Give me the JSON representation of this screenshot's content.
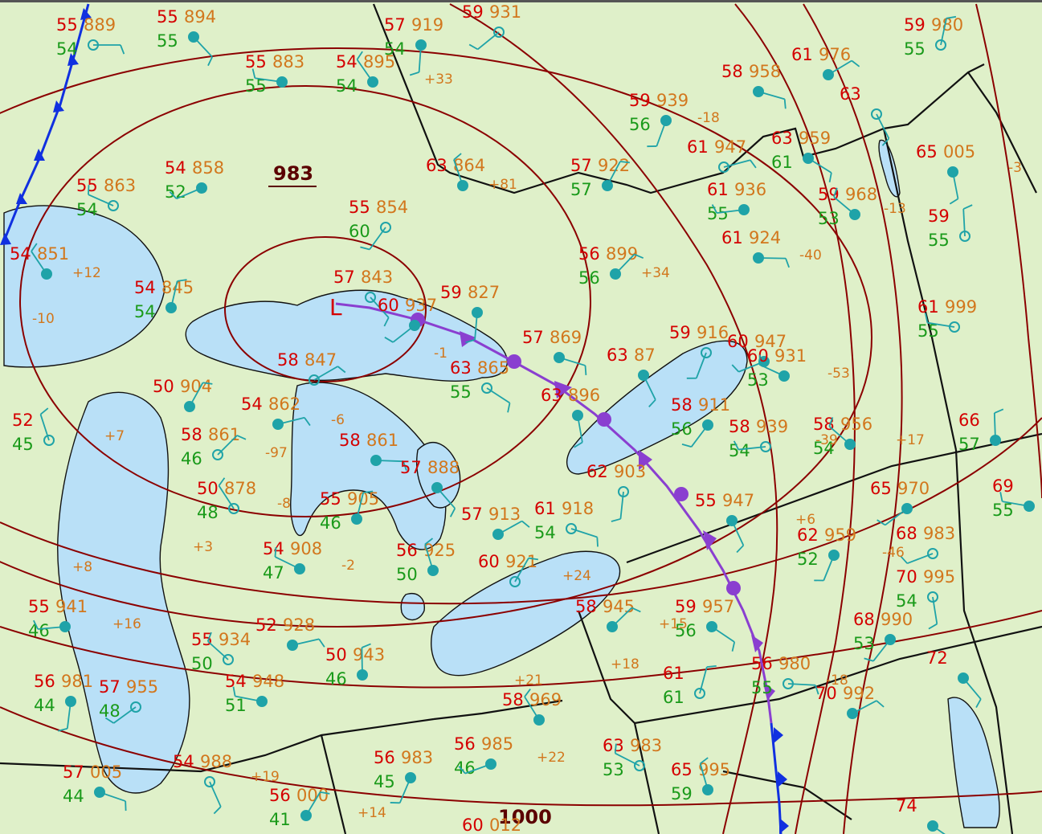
{
  "map": {
    "low_center": {
      "symbol": "L",
      "pressure_label": "983"
    },
    "isobar_labels": [
      "983",
      "1000"
    ],
    "fronts": [
      {
        "name": "occluded-front",
        "color": "#8a3fd0"
      },
      {
        "name": "cold-front-west",
        "color": "#1030e0"
      },
      {
        "name": "cold-front-south",
        "color": "#1030e0"
      }
    ],
    "colors": {
      "land": "#dff0c9",
      "water": "#b9e0f7",
      "temperature": "#d40000",
      "dewpoint": "#1a9a1a",
      "pressure": "#d2771d",
      "wind": "#1fa3a8",
      "isobar": "#8b0000",
      "weather_symbol": "#cc00cc"
    },
    "stations": [
      {
        "t": "55",
        "p": "889",
        "d": "54"
      },
      {
        "t": "55",
        "p": "894",
        "d": "55"
      },
      {
        "t": "57",
        "p": "919",
        "d": "54"
      },
      {
        "t": "59",
        "p": "931"
      },
      {
        "t": "55",
        "p": "883",
        "d": "55"
      },
      {
        "t": "54",
        "p": "895",
        "d": "54"
      },
      {
        "t": "59",
        "p": "980",
        "d": "55"
      },
      {
        "t": "61",
        "p": "976"
      },
      {
        "t": "58",
        "p": "958"
      },
      {
        "t": "63"
      },
      {
        "t": "59",
        "p": "939",
        "d": "56"
      },
      {
        "t": "54",
        "p": "858",
        "d": "52"
      },
      {
        "t": "55",
        "p": "863",
        "d": "54"
      },
      {
        "t": "63",
        "p": "864",
        "tend": "+81"
      },
      {
        "t": "57",
        "p": "922",
        "d": "57"
      },
      {
        "t": "61",
        "p": "947"
      },
      {
        "t": "63",
        "p": "959",
        "d": "61"
      },
      {
        "t": "65",
        "p": "005"
      },
      {
        "t": "55",
        "p": "854",
        "d": "60"
      },
      {
        "t": "61",
        "p": "936",
        "d": "55"
      },
      {
        "t": "59",
        "p": "968",
        "d": "53"
      },
      {
        "t": "59",
        "d": "55"
      },
      {
        "t": "56",
        "p": "899",
        "d": "56",
        "tend": "+34"
      },
      {
        "t": "61",
        "p": "924"
      },
      {
        "t": "57",
        "p": "843"
      },
      {
        "t": "59",
        "p": "827"
      },
      {
        "t": "60",
        "p": "937"
      },
      {
        "t": "61",
        "p": "999",
        "d": "55"
      },
      {
        "t": "54",
        "p": "851",
        "tend": "+12"
      },
      {
        "t": "54",
        "p": "845",
        "d": "54"
      },
      {
        "t": "58",
        "p": "847"
      },
      {
        "t": "57",
        "p": "869"
      },
      {
        "t": "63",
        "p": "87"
      },
      {
        "t": "59",
        "p": "916"
      },
      {
        "t": "60",
        "p": "947"
      },
      {
        "t": "60",
        "p": "931",
        "d": "53"
      },
      {
        "t": "52",
        "d": "45"
      },
      {
        "t": "50",
        "p": "904"
      },
      {
        "t": "54",
        "p": "862"
      },
      {
        "t": "63",
        "p": "865",
        "d": "55"
      },
      {
        "t": "63",
        "p": "896"
      },
      {
        "t": "58",
        "p": "911",
        "d": "56"
      },
      {
        "t": "58",
        "p": "939",
        "d": "54"
      },
      {
        "t": "58",
        "p": "956",
        "d": "54"
      },
      {
        "t": "66",
        "d": "57"
      },
      {
        "t": "58",
        "p": "861",
        "d": "46"
      },
      {
        "t": "58",
        "p": "861"
      },
      {
        "t": "57",
        "p": "888"
      },
      {
        "t": "62",
        "p": "903"
      },
      {
        "t": "65",
        "p": "970"
      },
      {
        "t": "69",
        "d": "55"
      },
      {
        "t": "50",
        "p": "878",
        "d": "48"
      },
      {
        "t": "55",
        "p": "905",
        "d": "46"
      },
      {
        "t": "57",
        "p": "913"
      },
      {
        "t": "61",
        "p": "918",
        "d": "54"
      },
      {
        "t": "55",
        "p": "947"
      },
      {
        "t": "62",
        "p": "959",
        "d": "52"
      },
      {
        "t": "68",
        "p": "983"
      },
      {
        "t": "54",
        "p": "908",
        "d": "47"
      },
      {
        "t": "56",
        "p": "925",
        "d": "50"
      },
      {
        "t": "60",
        "p": "921"
      },
      {
        "t": "52",
        "p": "928"
      },
      {
        "t": "59",
        "p": "957",
        "d": "56"
      },
      {
        "t": "70",
        "p": "995",
        "d": "54"
      },
      {
        "t": "68",
        "p": "990",
        "d": "53"
      },
      {
        "t": "55",
        "p": "941",
        "d": "46"
      },
      {
        "t": "55",
        "p": "934",
        "d": "50"
      },
      {
        "t": "50",
        "p": "943",
        "d": "46"
      },
      {
        "t": "58",
        "p": "945"
      },
      {
        "t": "56",
        "p": "980",
        "d": "55"
      },
      {
        "t": "72"
      },
      {
        "t": "56",
        "p": "981",
        "d": "44"
      },
      {
        "t": "57",
        "p": "955",
        "d": "48"
      },
      {
        "t": "54",
        "p": "948",
        "d": "51"
      },
      {
        "t": "58",
        "p": "969"
      },
      {
        "t": "61",
        "d": "61"
      },
      {
        "t": "70",
        "p": "992"
      },
      {
        "t": "57",
        "p": "005",
        "d": "44"
      },
      {
        "t": "54",
        "p": "988"
      },
      {
        "t": "56",
        "p": "983",
        "d": "45"
      },
      {
        "t": "56",
        "p": "985",
        "d": "46"
      },
      {
        "t": "63",
        "p": "983",
        "d": "53"
      },
      {
        "t": "65",
        "p": "995",
        "d": "59"
      },
      {
        "t": "56",
        "p": "000",
        "d": "41"
      },
      {
        "t": "60",
        "p": "012"
      },
      {
        "t": "74"
      }
    ],
    "tendencies": [
      "+33",
      "-18",
      "-40",
      "-13",
      "-3",
      "-10",
      "+7",
      "+8",
      "-97",
      "-8",
      "+3",
      "-2",
      "-6",
      "-1",
      "+16",
      "+15",
      "+18",
      "+24",
      "+22",
      "+19",
      "+14",
      "+6",
      "-46",
      "-39",
      "-53",
      "+17",
      "-18",
      "+21"
    ]
  }
}
